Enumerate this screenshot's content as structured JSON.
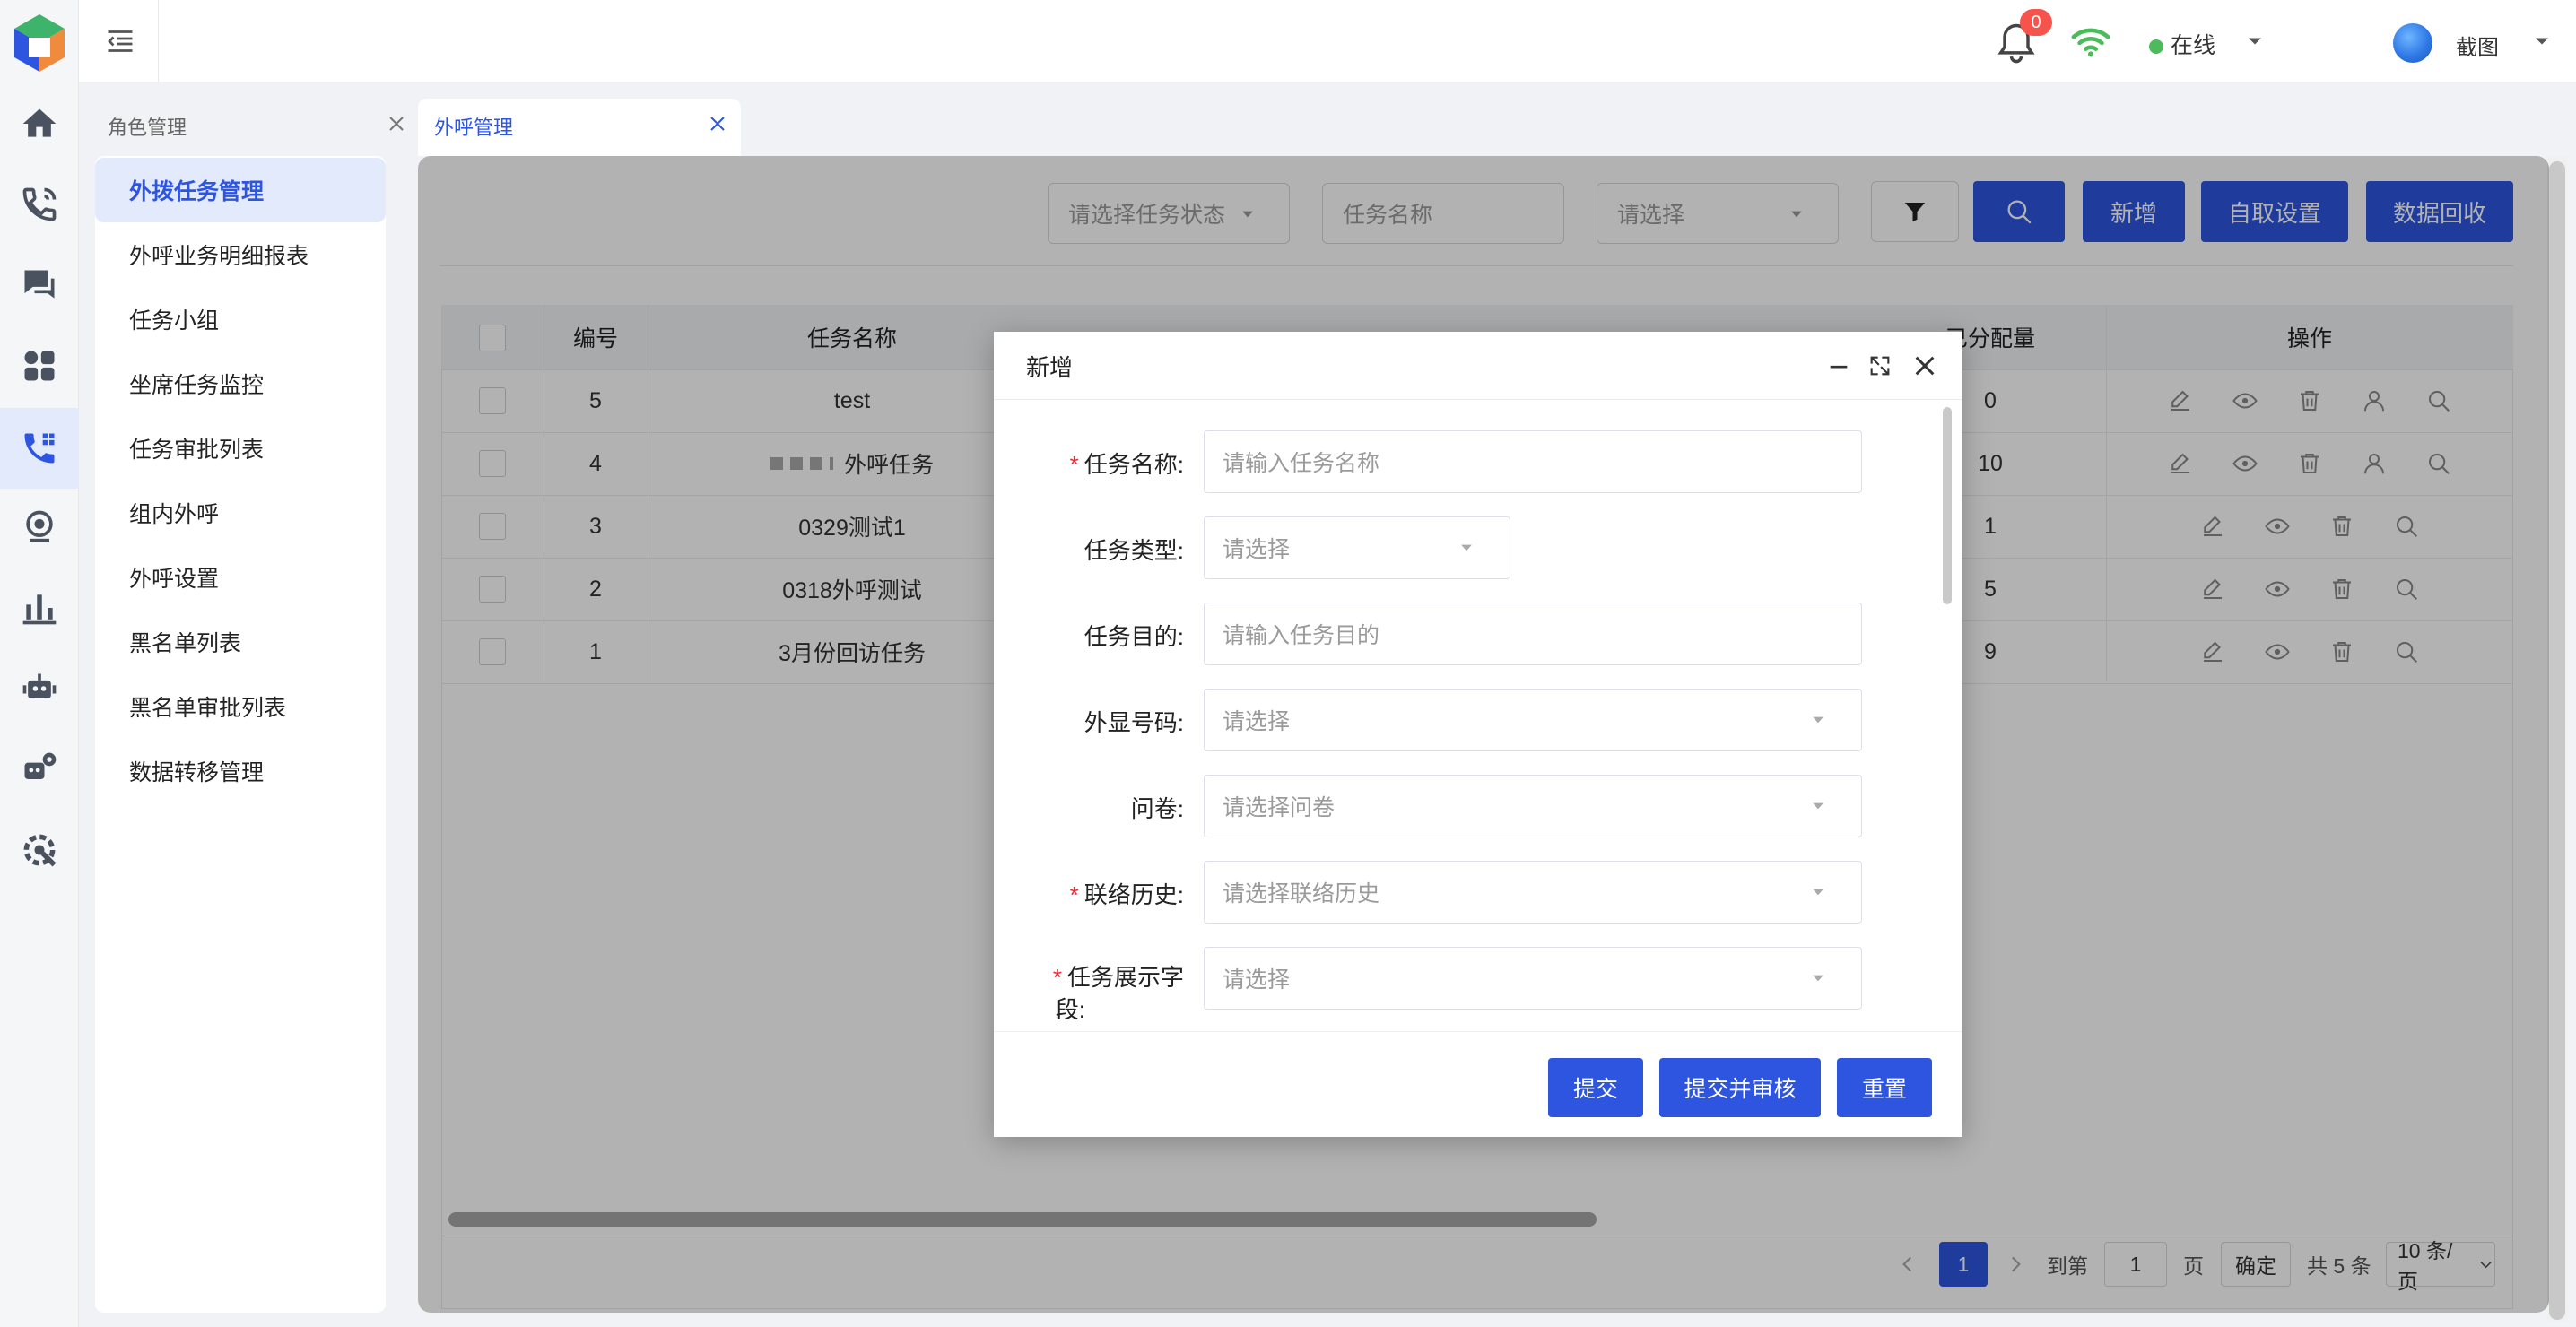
{
  "topbar": {
    "notification_count": "0",
    "status_label": "在线",
    "user_label": "截图"
  },
  "tabs": [
    {
      "label": "角色管理",
      "active": false
    },
    {
      "label": "外呼管理",
      "active": true
    }
  ],
  "submenu": [
    {
      "label": "外拨任务管理",
      "active": true
    },
    {
      "label": "外呼业务明细报表"
    },
    {
      "label": "任务小组"
    },
    {
      "label": "坐席任务监控"
    },
    {
      "label": "任务审批列表"
    },
    {
      "label": "组内外呼"
    },
    {
      "label": "外呼设置"
    },
    {
      "label": "黑名单列表"
    },
    {
      "label": "黑名单审批列表"
    },
    {
      "label": "数据转移管理"
    }
  ],
  "filters": {
    "status_placeholder": "请选择任务状态",
    "name_placeholder": "任务名称",
    "select_placeholder": "请选择"
  },
  "toolbar": {
    "add_label": "新增",
    "auto_fetch_label": "自取设置",
    "data_recycle_label": "数据回收"
  },
  "table": {
    "headers": [
      "编号",
      "任务名称",
      "已分配量",
      "操作"
    ],
    "rows": [
      {
        "id": "5",
        "name": "test",
        "allocated": "0"
      },
      {
        "id": "4",
        "name": "外呼任务",
        "allocated": "10"
      },
      {
        "id": "3",
        "name": "0329测试1",
        "allocated": "1"
      },
      {
        "id": "2",
        "name": "0318外呼测试",
        "allocated": "5"
      },
      {
        "id": "1",
        "name": "3月份回访任务",
        "allocated": "9"
      }
    ]
  },
  "pagination": {
    "current_page": "1",
    "goto_label": "到第",
    "goto_value": "1",
    "page_unit": "页",
    "confirm_label": "确定",
    "total_label": "共 5 条",
    "page_size_label": "10 条/页"
  },
  "modal": {
    "title": "新增",
    "fields": [
      {
        "label": "任务名称:",
        "required": true,
        "placeholder": "请输入任务名称"
      },
      {
        "label": "任务类型:",
        "required": false,
        "placeholder": "请选择"
      },
      {
        "label": "任务目的:",
        "required": false,
        "placeholder": "请输入任务目的"
      },
      {
        "label": "外显号码:",
        "required": false,
        "placeholder": "请选择"
      },
      {
        "label": "问卷:",
        "required": false,
        "placeholder": "请选择问卷"
      },
      {
        "label": "联络历史:",
        "required": true,
        "placeholder": "请选择联络历史"
      },
      {
        "label": "任务展示字段:",
        "label_line1": "任务展示字",
        "label_line2": "段:",
        "required": true,
        "placeholder": "请选择"
      }
    ],
    "submit_label": "提交",
    "submit_review_label": "提交并审核",
    "reset_label": "重置"
  },
  "colors": {
    "primary": "#2d55e0",
    "required": "#f5222d",
    "online": "#4cbb5c",
    "badge": "#f5534c"
  }
}
